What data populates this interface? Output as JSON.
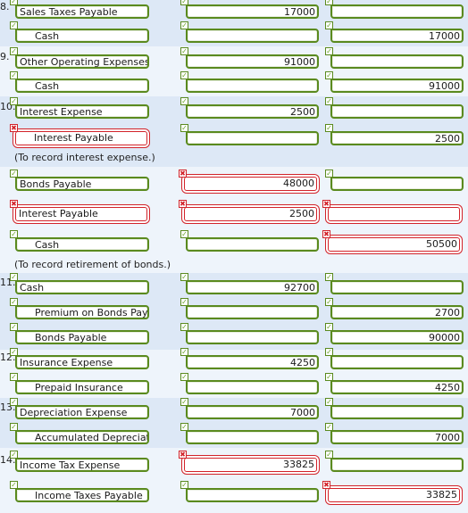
{
  "colors": {
    "correct": "#5a8a1e",
    "incorrect": "#d2232a",
    "band_dark": "#dde8f6",
    "band_light": "#eef4fb"
  },
  "icons": {
    "correct": "checkmark-icon",
    "incorrect": "x-mark-icon"
  },
  "entries": [
    {
      "number": "8.",
      "lines": [
        {
          "account": "Sales Taxes Payable",
          "debit": "17000",
          "credit": "",
          "status": [
            "ok",
            "ok",
            "ok"
          ]
        },
        {
          "account": "Cash",
          "debit": "",
          "credit": "17000",
          "status": [
            "ok",
            "ok",
            "ok"
          ]
        }
      ]
    },
    {
      "number": "9.",
      "lines": [
        {
          "account": "Other Operating Expenses",
          "debit": "91000",
          "credit": "",
          "status": [
            "ok",
            "ok",
            "ok"
          ]
        },
        {
          "account": "Cash",
          "debit": "",
          "credit": "91000",
          "status": [
            "ok",
            "ok",
            "ok"
          ]
        }
      ]
    },
    {
      "number": "10.",
      "lines": [
        {
          "account": "Interest Expense",
          "debit": "2500",
          "credit": "",
          "status": [
            "ok",
            "ok",
            "ok"
          ]
        },
        {
          "account": "Interest Payable",
          "debit": "",
          "credit": "2500",
          "status": [
            "bad",
            "ok",
            "ok"
          ]
        }
      ],
      "note": "(To record interest expense.)"
    },
    {
      "number": "",
      "lines": [
        {
          "account": "Bonds Payable",
          "debit": "48000",
          "credit": "",
          "status": [
            "ok",
            "bad",
            "ok"
          ]
        },
        {
          "account": "Interest Payable",
          "debit": "2500",
          "credit": "",
          "status": [
            "bad",
            "bad",
            "bad"
          ]
        },
        {
          "account": "Cash",
          "debit": "",
          "credit": "50500",
          "status": [
            "ok",
            "ok",
            "bad"
          ]
        }
      ],
      "note": "(To record retirement of bonds.)"
    },
    {
      "number": "11.",
      "lines": [
        {
          "account": "Cash",
          "debit": "92700",
          "credit": "",
          "status": [
            "ok",
            "ok",
            "ok"
          ]
        },
        {
          "account": "Premium on Bonds Pay",
          "debit": "",
          "credit": "2700",
          "status": [
            "ok",
            "ok",
            "ok"
          ]
        },
        {
          "account": "Bonds Payable",
          "debit": "",
          "credit": "90000",
          "status": [
            "ok",
            "ok",
            "ok"
          ]
        }
      ]
    },
    {
      "number": "12.",
      "lines": [
        {
          "account": "Insurance Expense",
          "debit": "4250",
          "credit": "",
          "status": [
            "ok",
            "ok",
            "ok"
          ]
        },
        {
          "account": "Prepaid Insurance",
          "debit": "",
          "credit": "4250",
          "status": [
            "ok",
            "ok",
            "ok"
          ]
        }
      ]
    },
    {
      "number": "13.",
      "lines": [
        {
          "account": "Depreciation Expense",
          "debit": "7000",
          "credit": "",
          "status": [
            "ok",
            "ok",
            "ok"
          ]
        },
        {
          "account": "Accumulated Depreciati",
          "debit": "",
          "credit": "7000",
          "status": [
            "ok",
            "ok",
            "ok"
          ]
        }
      ]
    },
    {
      "number": "14.",
      "lines": [
        {
          "account": "Income Tax Expense",
          "debit": "33825",
          "credit": "",
          "status": [
            "ok",
            "bad",
            "ok"
          ]
        },
        {
          "account": "Income Taxes Payable",
          "debit": "",
          "credit": "33825",
          "status": [
            "ok",
            "ok",
            "bad"
          ]
        }
      ]
    }
  ]
}
